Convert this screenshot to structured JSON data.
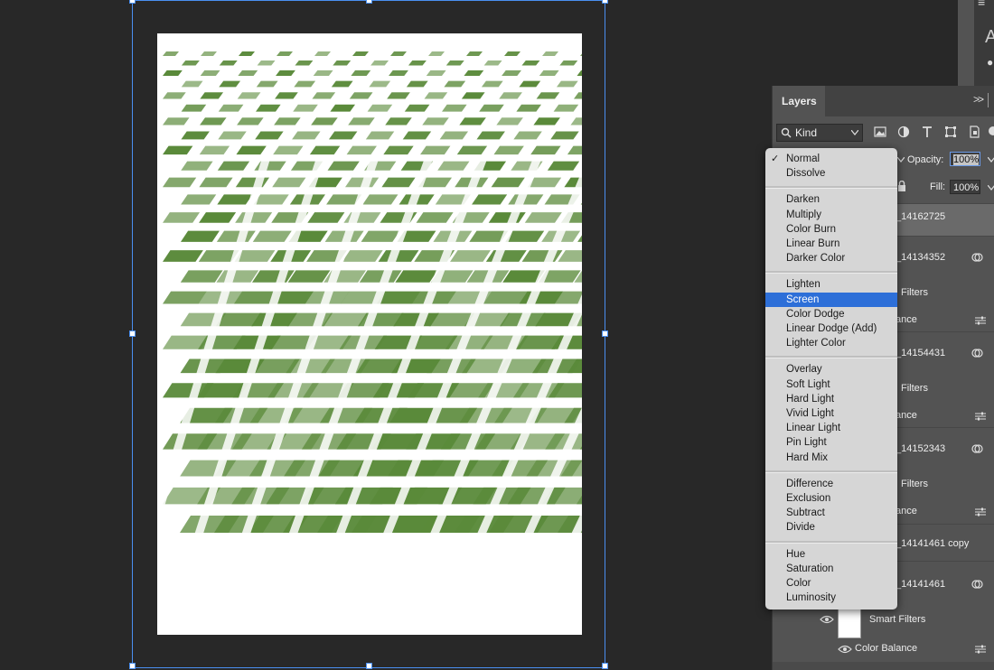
{
  "canvas": {
    "doc_bg": "#ffffff",
    "pattern_color": "#5a8a3a",
    "artboard_color": "#4a8ff0"
  },
  "topright": {
    "glyph": "A",
    "bullet": "●",
    "menu_glyph": "≡"
  },
  "panel": {
    "tab": "Layers",
    "collapse": ">>",
    "kind_filter": {
      "label": "Kind",
      "icons": [
        "image-filter-icon",
        "adjustment-filter-icon",
        "type-filter-icon",
        "shape-filter-icon",
        "smart-object-filter-icon"
      ]
    },
    "opacity_label": "Opacity:",
    "opacity_value": "100%",
    "fill_label": "Fill:",
    "fill_value": "100%",
    "layers": [
      {
        "name": "_14162725"
      },
      {
        "name": "_14134352"
      },
      {
        "name": "Filters"
      },
      {
        "name": "ance"
      },
      {
        "name": "_14154431"
      },
      {
        "name": "Filters"
      },
      {
        "name": "ance"
      },
      {
        "name": "_14152343"
      },
      {
        "name": "Filters"
      },
      {
        "name": "ance"
      },
      {
        "name": "_14141461 copy"
      },
      {
        "name": "_14141461"
      },
      {
        "name": "Smart Filters"
      },
      {
        "name": "Color Balance"
      }
    ]
  },
  "blend_menu": {
    "groups": [
      [
        "Normal",
        "Dissolve"
      ],
      [
        "Darken",
        "Multiply",
        "Color Burn",
        "Linear Burn",
        "Darker Color"
      ],
      [
        "Lighten",
        "Screen",
        "Color Dodge",
        "Linear Dodge (Add)",
        "Lighter Color"
      ],
      [
        "Overlay",
        "Soft Light",
        "Hard Light",
        "Vivid Light",
        "Linear Light",
        "Pin Light",
        "Hard Mix"
      ],
      [
        "Difference",
        "Exclusion",
        "Subtract",
        "Divide"
      ],
      [
        "Hue",
        "Saturation",
        "Color",
        "Luminosity"
      ]
    ],
    "checked": "Normal",
    "highlighted": "Screen",
    "highlight_color": "#2d6fd8"
  }
}
